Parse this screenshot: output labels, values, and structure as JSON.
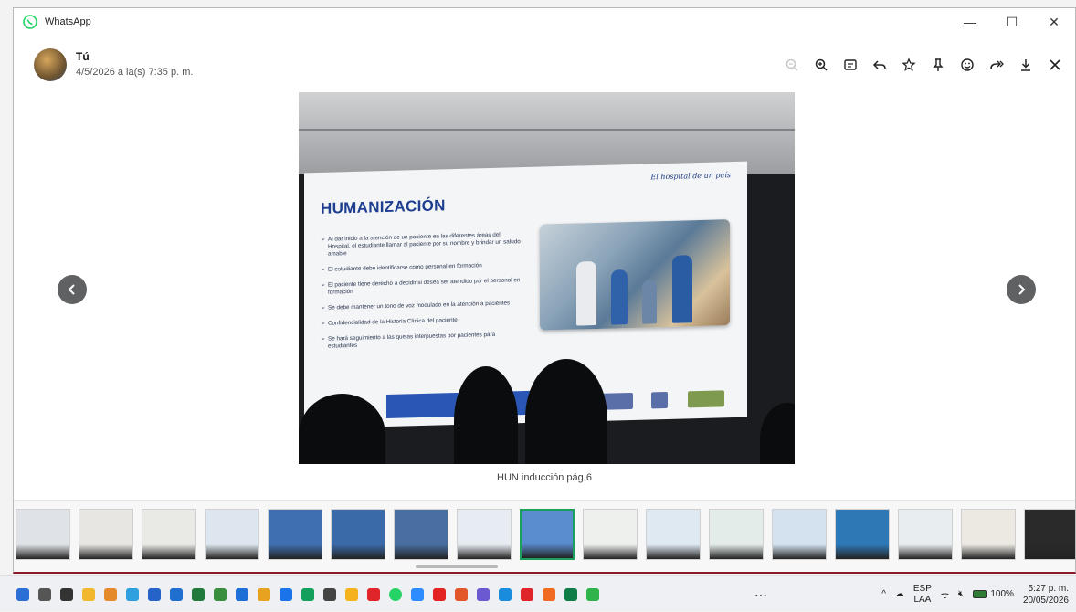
{
  "window": {
    "app_title": "WhatsApp",
    "controls": {
      "minimize": "—",
      "maximize": "☐",
      "close": "✕"
    }
  },
  "message": {
    "sender": "Tú",
    "timestamp": "4/5/2026 a la(s) 7:35 p. m."
  },
  "toolbar": {
    "icons": [
      "zoom-out-icon",
      "zoom-in-icon",
      "caption-icon",
      "reply-icon",
      "star-icon",
      "pin-icon",
      "emoji-icon",
      "forward-icon",
      "download-icon",
      "close-icon"
    ]
  },
  "slide": {
    "script_text": "El hospital de un país",
    "title": "HUMANIZACIÓN",
    "bullets": [
      "Al dar inicio a la atención de un paciente en las diferentes áreas del Hospital, el estudiante llamar al paciente por su nombre y brindar un saludo amable",
      "El estudiante debe identificarse como personal en formación",
      "El paciente tiene derecho a decidir si desea ser atendido por el personal en formación",
      "Se debe mantener un tono de voz modulado en la atención a pacientes",
      "Confidencialidad de la Historia Clínica del paciente",
      "Se hará seguimiento a las quejas interpuestas por pacientes para estudiantes"
    ]
  },
  "caption": "HUN inducción pág 6",
  "thumbnails": {
    "count": 17,
    "selected_index": 8
  },
  "taskbar": {
    "colors": [
      "#2b6fd6",
      "#555555",
      "#333333",
      "#f1b82d",
      "#e58a2b",
      "#2ea0e0",
      "#2563c9",
      "#1f6fd1",
      "#1f7a3c",
      "#3a8f3f",
      "#1d6fd8",
      "#e7a21f",
      "#1a73e8",
      "#12a05c",
      "#444444",
      "#f6b21c",
      "#e0242a",
      "#25d366",
      "#2d8cff",
      "#e32222",
      "#e2562a",
      "#6a59d1",
      "#1a8cde",
      "#e0242a",
      "#f06a22",
      "#0f7c48",
      "#2fb34b"
    ],
    "more_label": "⋯",
    "tray": {
      "chevron": "^",
      "lang_top": "ESP",
      "lang_bottom": "LAA",
      "wifi": "ᯤ",
      "volume": "🔇︎",
      "battery_label": "100%",
      "time": "5:27 p. m.",
      "date": "20/05/2026"
    }
  }
}
